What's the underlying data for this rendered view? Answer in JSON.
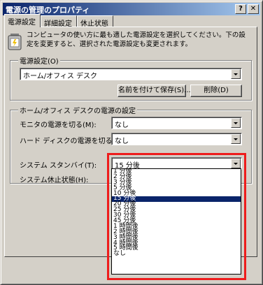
{
  "title": "電源の管理のプロパティ",
  "caption_buttons": {
    "help": "?",
    "close": "✕"
  },
  "tabs": [
    {
      "label": "電源設定"
    },
    {
      "label": "詳細設定"
    },
    {
      "label": "休止状態"
    }
  ],
  "description": "コンピュータの使い方に最も適した電源設定を選択してください。下の設定を変更すると、選択された電源設定も変更されます。",
  "power_scheme": {
    "group_label": "電源設定(O)",
    "selected": "ホーム/オフィス デスク",
    "save_as_label": "名前を付けて保存(S)...",
    "delete_label": "削除(D)"
  },
  "settings": {
    "group_label": "ホーム/オフィス デスクの電源の設定",
    "monitor_label": "モニタの電源を切る(M):",
    "monitor_value": "なし",
    "hdd_label": "ハード ディスクの電源を切る(I):",
    "hdd_value": "なし",
    "standby_label": "システム スタンバイ(T):",
    "standby_value": "15 分後",
    "hibernate_label": "システム休止状態(H):"
  },
  "standby_options": [
    "1 分後",
    "2 分後",
    "3 分後",
    "5 分後",
    "10 分後",
    "15 分後",
    "20 分後",
    "25 分後",
    "30 分後",
    "45 分後",
    "1 時間後",
    "2 時間後",
    "3 時間後",
    "4 時間後",
    "5 時間後",
    "なし"
  ],
  "standby_selected_index": 5,
  "colors": {
    "highlight_border": "#ee1c1c",
    "selection": "#0a246a",
    "titlebar": "#0a246a"
  }
}
